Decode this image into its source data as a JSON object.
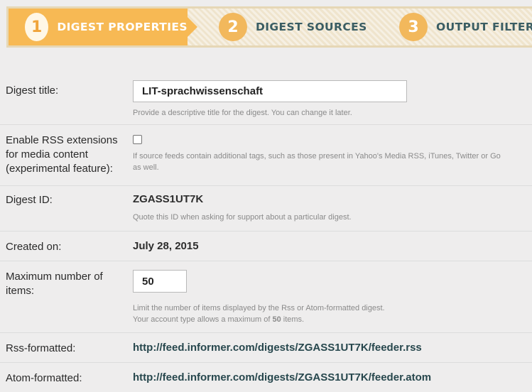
{
  "wizard": {
    "steps": [
      {
        "number": "1",
        "label": "DIGEST PROPERTIES",
        "active": true
      },
      {
        "number": "2",
        "label": "DIGEST SOURCES",
        "active": false
      },
      {
        "number": "3",
        "label": "OUTPUT FILTERS",
        "active": false
      }
    ]
  },
  "form": {
    "title": {
      "label": "Digest title:",
      "value": "LIT-sprachwissenschaft",
      "help": "Provide a descriptive title for the digest. You can change it later."
    },
    "rss_extensions": {
      "label_line1": "Enable RSS extensions",
      "label_line2": "for media content",
      "label_line3": "(experimental feature):",
      "checked": false,
      "help_line1": "If source feeds contain additional tags, such as those present in Yahoo's Media RSS, iTunes, Twitter or Go",
      "help_line2": "as well."
    },
    "digest_id": {
      "label": "Digest ID:",
      "value": "ZGASS1UT7K",
      "help": "Quote this ID when asking for support about a particular digest."
    },
    "created_on": {
      "label": "Created on:",
      "value": "July 28, 2015"
    },
    "max_items": {
      "label_line1": "Maximum number of",
      "label_line2": "items:",
      "value": "50",
      "help_line1": "Limit the number of items displayed by the Rss or Atom-formatted digest.",
      "help_line2_prefix": "Your account type allows a maximum of ",
      "help_line2_max": "50",
      "help_line2_suffix": " items."
    },
    "rss_formatted": {
      "label": "Rss-formatted:",
      "url": "http://feed.informer.com/digests/ZGASS1UT7K/feeder.rss"
    },
    "atom_formatted": {
      "label": "Atom-formatted:",
      "url": "http://feed.informer.com/digests/ZGASS1UT7K/feeder.atom"
    }
  }
}
